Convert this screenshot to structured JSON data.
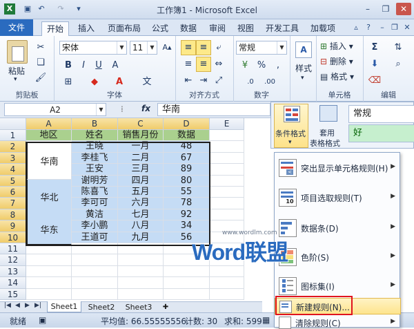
{
  "window": {
    "title": "工作簿1 - Microsoft Excel"
  },
  "tabs": [
    {
      "label": "文件",
      "kind": "file"
    },
    {
      "label": "开始",
      "kind": "active"
    },
    {
      "label": "插入"
    },
    {
      "label": "页面布局"
    },
    {
      "label": "公式"
    },
    {
      "label": "数据"
    },
    {
      "label": "审阅"
    },
    {
      "label": "视图"
    },
    {
      "label": "开发工具"
    },
    {
      "label": "加载项"
    }
  ],
  "ribbon": {
    "clipboard": {
      "paste": "粘贴",
      "label": "剪贴板"
    },
    "font": {
      "name": "宋体",
      "size": "11",
      "label": "字体"
    },
    "alignment": {
      "label": "对齐方式"
    },
    "number": {
      "format": "常规",
      "label": "数字"
    },
    "styles": {
      "label": "样式"
    },
    "cells": {
      "insert": "插入",
      "delete": "删除",
      "format": "格式",
      "label": "单元格"
    },
    "editing": {
      "label": "编辑"
    }
  },
  "formula": {
    "name_box": "A2",
    "fx": "fx",
    "value": "华南"
  },
  "grid": {
    "columns": [
      "A",
      "B",
      "C",
      "D",
      "E"
    ],
    "rows": [
      "1",
      "2",
      "3",
      "4",
      "5",
      "6",
      "7",
      "8",
      "9",
      "10",
      "11",
      "12",
      "13",
      "14",
      "15"
    ],
    "header_row": [
      "地区",
      "姓名",
      "销售月份",
      "数据"
    ],
    "regions": [
      "华南",
      "华北",
      "华东"
    ],
    "names": [
      "王晓",
      "李桂飞",
      "王安",
      "谢明芳",
      "陈喜飞",
      "李可可",
      "黄洁",
      "李小鹏",
      "王道可"
    ],
    "months": [
      "一月",
      "二月",
      "三月",
      "四月",
      "五月",
      "六月",
      "七月",
      "八月",
      "九月"
    ],
    "values": [
      "48",
      "67",
      "89",
      "80",
      "55",
      "78",
      "92",
      "34",
      "56"
    ]
  },
  "sheets": [
    "Sheet1",
    "Sheet2",
    "Sheet3"
  ],
  "status": {
    "mode": "就绪",
    "average": "平均值: 66.55555556",
    "count": "计数: 30",
    "sum": "求和: 599"
  },
  "styles_panel": {
    "cond_format": "条件格式",
    "table_format_1": "套用",
    "table_format_2": "表格格式",
    "normal": "常规",
    "good": "好"
  },
  "menu": {
    "items": [
      {
        "label": "突出显示单元格规则(H)",
        "arrow": true
      },
      {
        "label": "项目选取规则(T)",
        "arrow": true
      },
      {
        "label": "数据条(D)",
        "arrow": true
      },
      {
        "label": "色阶(S)",
        "arrow": true
      },
      {
        "label": "图标集(I)",
        "arrow": true
      },
      {
        "label": "新建规则(N)...",
        "arrow": false
      },
      {
        "label": "清除规则(C)",
        "arrow": true
      }
    ]
  },
  "watermark": {
    "brand": "Word联盟",
    "url": "www.wordlm.com"
  },
  "colors": {
    "selection": "#c5dcf5",
    "header_fill": "#aad08e",
    "file_tab": "#2a6bbf",
    "highlight": "#fde48d",
    "red_box": "#e0141e"
  }
}
